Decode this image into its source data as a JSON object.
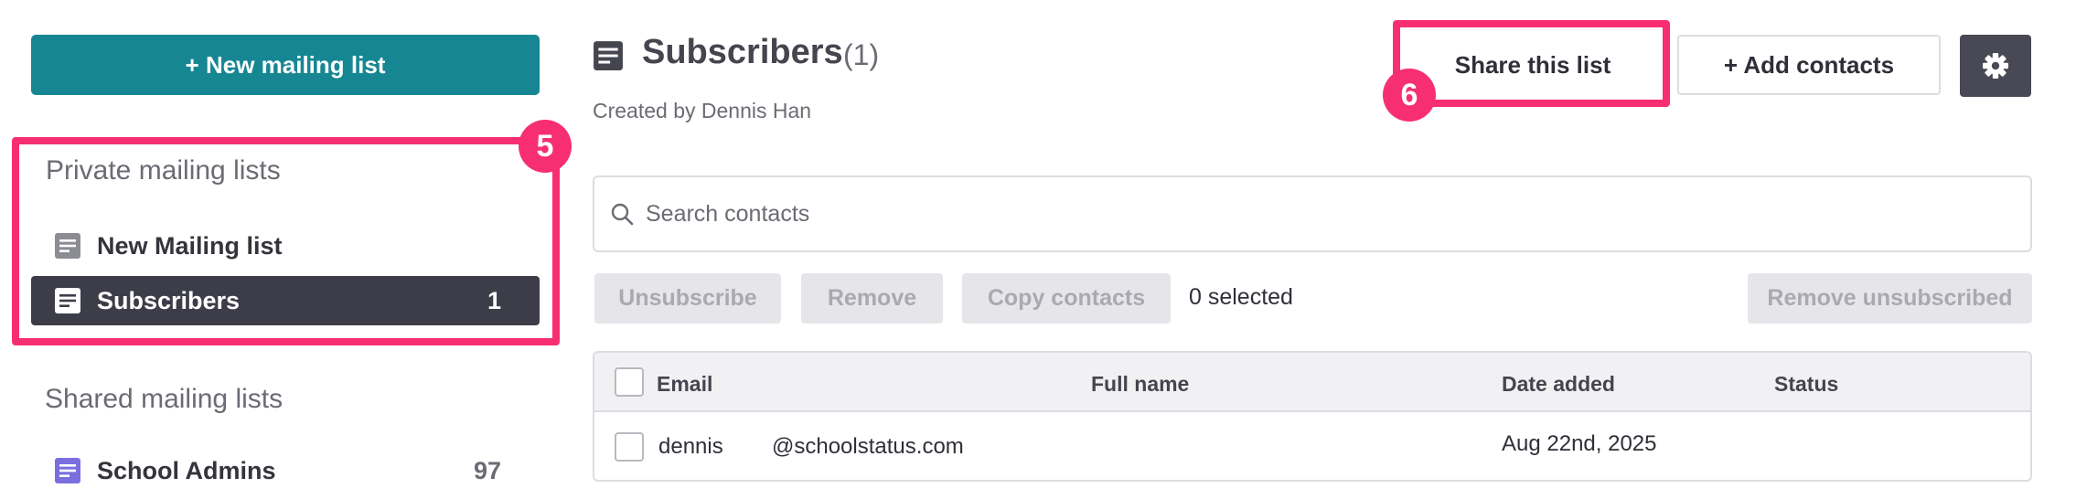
{
  "sidebar": {
    "new_list_label": "+ New mailing list",
    "private_heading": "Private mailing lists",
    "shared_heading": "Shared mailing lists",
    "private_lists": [
      {
        "label": "New Mailing list",
        "count": "",
        "icon": "list-icon"
      },
      {
        "label": "Subscribers",
        "count": "1",
        "icon": "list-icon",
        "active": true
      }
    ],
    "shared_lists": [
      {
        "label": "School Admins",
        "count": "97",
        "icon": "list-icon"
      }
    ]
  },
  "header": {
    "title": "Subscribers",
    "count": "(1)",
    "created_by": "Created by Dennis Han",
    "share_label": "Share this list",
    "add_contacts_label": "+ Add contacts",
    "settings_icon": "gear-icon"
  },
  "search": {
    "placeholder": "Search contacts",
    "icon": "search-icon"
  },
  "actions": {
    "unsubscribe": "Unsubscribe",
    "remove": "Remove",
    "copy_contacts": "Copy contacts",
    "selected": "0 selected",
    "remove_unsubscribed": "Remove unsubscribed"
  },
  "table": {
    "columns": [
      "Email",
      "Full name",
      "Date added",
      "Status"
    ],
    "rows": [
      {
        "email_user": "dennis",
        "email_domain": "@schoolstatus.com",
        "full_name": "",
        "date_added": "Aug 22nd, 2025",
        "status": ""
      }
    ]
  },
  "annotations": {
    "marker_5": "5",
    "marker_6": "6"
  },
  "colors": {
    "primary": "#168792",
    "active_item": "#3d3d4a",
    "highlight": "#f72f72",
    "shared_icon": "#7b6fe0",
    "private_icon": "#8c8c94"
  }
}
